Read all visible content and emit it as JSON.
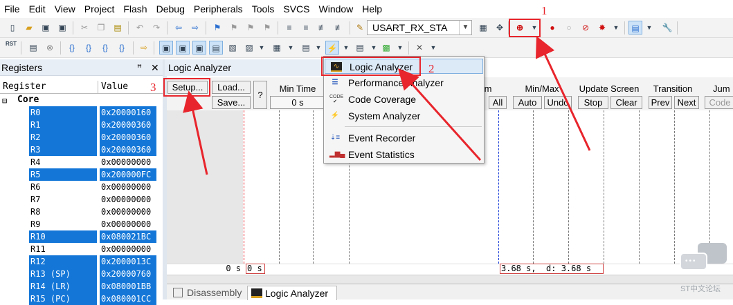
{
  "menubar": [
    "File",
    "Edit",
    "View",
    "Project",
    "Flash",
    "Debug",
    "Peripherals",
    "Tools",
    "SVCS",
    "Window",
    "Help"
  ],
  "toolbar": {
    "target_combo": "USART_RX_STA",
    "rst_label": "RST"
  },
  "callouts": {
    "one": "1",
    "two": "2",
    "three": "3"
  },
  "registers": {
    "title": "Registers",
    "col_register": "Register",
    "col_value": "Value",
    "group": "Core",
    "rows": [
      {
        "name": "R0",
        "value": "0x20000160"
      },
      {
        "name": "R1",
        "value": "0x20000360"
      },
      {
        "name": "R2",
        "value": "0x20000360"
      },
      {
        "name": "R3",
        "value": "0x20000360"
      },
      {
        "name": "R4",
        "value": "0x00000000"
      },
      {
        "name": "R5",
        "value": "0x200000FC"
      },
      {
        "name": "R6",
        "value": "0x00000000"
      },
      {
        "name": "R7",
        "value": "0x00000000"
      },
      {
        "name": "R8",
        "value": "0x00000000"
      },
      {
        "name": "R9",
        "value": "0x00000000"
      },
      {
        "name": "R10",
        "value": "0x080021BC"
      },
      {
        "name": "R11",
        "value": "0x00000000"
      },
      {
        "name": "R12",
        "value": "0x2000013C"
      },
      {
        "name": "R13 (SP)",
        "value": "0x20000760"
      },
      {
        "name": "R14 (LR)",
        "value": "0x080001BB"
      },
      {
        "name": "R15 (PC)",
        "value": "0x080001CC"
      }
    ]
  },
  "logic_analyzer": {
    "title": "Logic Analyzer",
    "setup": "Setup...",
    "load": "Load...",
    "save": "Save...",
    "help": "?",
    "min_time_label": "Min Time",
    "min_time_value": "0 s",
    "zoom_label": "m",
    "all": "All",
    "minmax_label": "Min/Max",
    "auto": "Auto",
    "undo": "Undo",
    "update_label": "Update Screen",
    "stop": "Stop",
    "clear": "Clear",
    "transition_label": "Transition",
    "prev": "Prev",
    "next": "Next",
    "jump_label": "Jum",
    "code": "Code",
    "time_left": "0 s",
    "cursor_left": "0 s",
    "cursor_right": "3.68 s,  d: 3.68 s"
  },
  "dropdown": [
    {
      "label": "Logic Analyzer",
      "icon": "logic-analyzer-icon"
    },
    {
      "label": "Performance Analyzer",
      "icon": "performance-analyzer-icon"
    },
    {
      "label": "Code Coverage",
      "icon": "code-coverage-icon"
    },
    {
      "label": "System Analyzer",
      "icon": "system-analyzer-icon"
    },
    {
      "label": "Event Recorder",
      "icon": "event-recorder-icon"
    },
    {
      "label": "Event Statistics",
      "icon": "event-statistics-icon"
    }
  ],
  "bottom_tabs": [
    "Disassembly",
    "Logic Analyzer"
  ],
  "watermark": "ST中文论坛",
  "colors": {
    "accent_red": "#e8252c",
    "selection_blue": "#1477d8"
  }
}
